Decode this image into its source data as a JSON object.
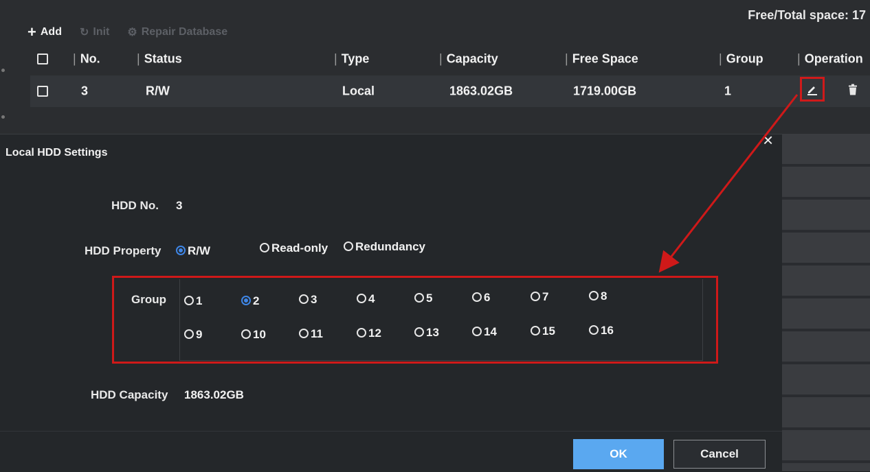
{
  "header": {
    "free_total_space": "Free/Total space: 17"
  },
  "toolbar": {
    "add_label": "Add",
    "init_label": "Init",
    "repair_label": "Repair Database"
  },
  "table": {
    "columns": [
      "No.",
      "Status",
      "Type",
      "Capacity",
      "Free Space",
      "Group",
      "Operation"
    ],
    "rows": [
      {
        "no": "3",
        "status": "R/W",
        "type": "Local",
        "capacity": "1863.02GB",
        "free_space": "1719.00GB",
        "group": "1"
      }
    ]
  },
  "dialog": {
    "title": "Local HDD Settings",
    "hdd_no_label": "HDD No.",
    "hdd_no_value": "3",
    "property_label": "HDD Property",
    "property_options": [
      "R/W",
      "Read-only",
      "Redundancy"
    ],
    "property_selected": "R/W",
    "group_label": "Group",
    "group_options": [
      "1",
      "2",
      "3",
      "4",
      "5",
      "6",
      "7",
      "8",
      "9",
      "10",
      "11",
      "12",
      "13",
      "14",
      "15",
      "16"
    ],
    "group_selected": "2",
    "capacity_label": "HDD Capacity",
    "capacity_value": "1863.02GB",
    "ok_label": "OK",
    "cancel_label": "Cancel"
  },
  "colors": {
    "highlight_red": "#cf1919",
    "accent_blue": "#3f86e6",
    "ok_button": "#5aa8f0"
  }
}
